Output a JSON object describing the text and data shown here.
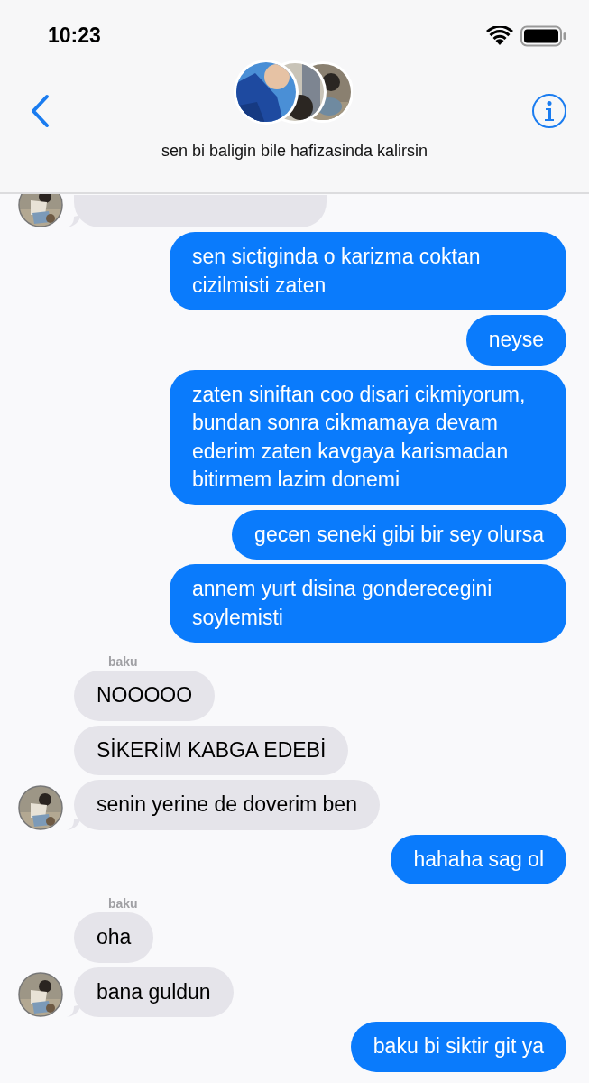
{
  "status_bar": {
    "time": "10:23"
  },
  "header": {
    "title": "sen bi baligin bile hafizasinda kalirsin"
  },
  "messages": [
    {
      "kind": "incoming",
      "clipped": true,
      "tail": true,
      "avatar": true
    },
    {
      "kind": "outgoing",
      "text": "sen sictiginda o karizma coktan cizilmisti zaten"
    },
    {
      "kind": "outgoing",
      "text": "neyse"
    },
    {
      "kind": "outgoing",
      "text": "zaten siniftan coo disari cikmiyorum, bundan sonra cikmamaya devam ederim zaten kavgaya karismadan bitirmem lazim donemi"
    },
    {
      "kind": "outgoing",
      "text": "gecen seneki gibi bir sey olursa"
    },
    {
      "kind": "outgoing",
      "text": "annem yurt disina gonderecegini soylemisti"
    },
    {
      "kind": "incoming",
      "sender": "baku",
      "text": "NOOOOO",
      "tail": false,
      "avatar": false
    },
    {
      "kind": "incoming",
      "text": "SİKERİM KABGA EDEBİ",
      "tail": false,
      "avatar": false
    },
    {
      "kind": "incoming",
      "text": "senin yerine de doverim ben",
      "tail": true,
      "avatar": true
    },
    {
      "kind": "outgoing",
      "text": "hahaha sag ol"
    },
    {
      "kind": "incoming",
      "sender": "baku",
      "text": "oha",
      "tail": false,
      "avatar": false
    },
    {
      "kind": "incoming",
      "text": "bana guldun",
      "tail": true,
      "avatar": true
    },
    {
      "kind": "outgoing",
      "text": "baku bi siktir git ya"
    }
  ]
}
